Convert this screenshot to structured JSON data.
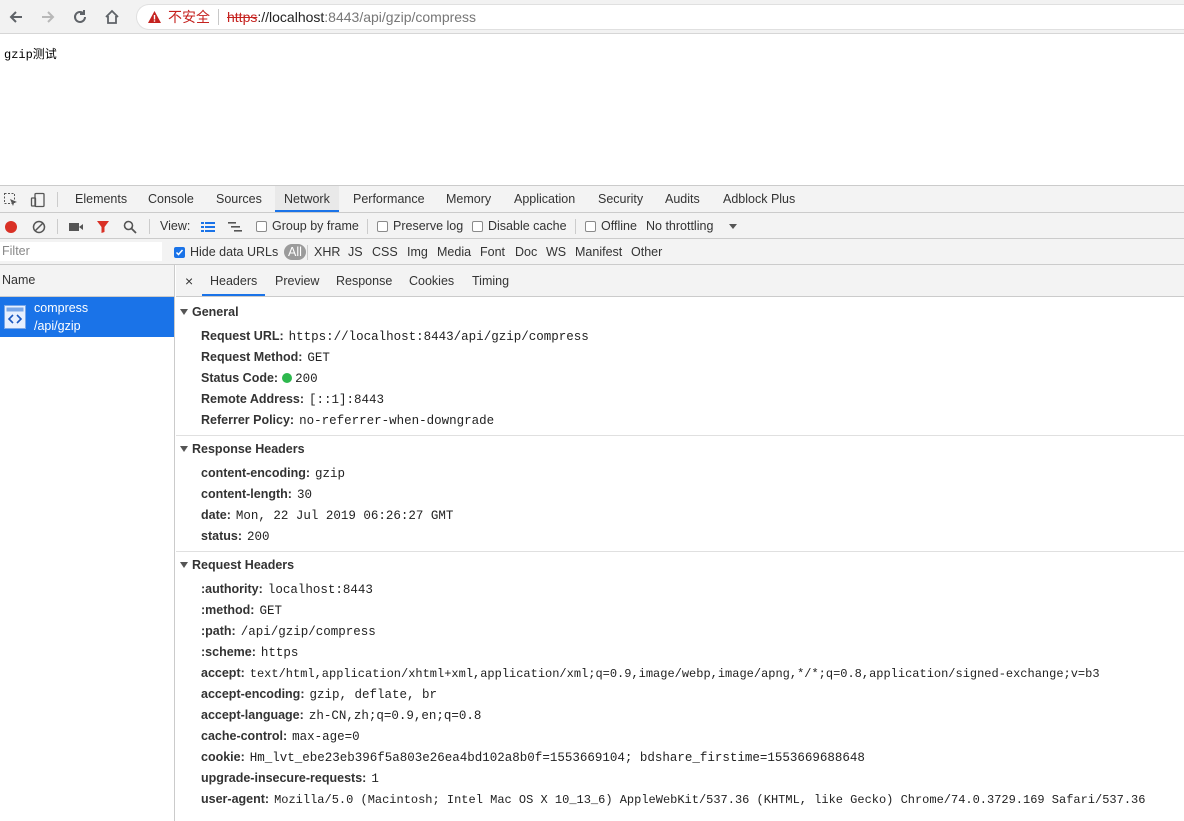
{
  "browser": {
    "insecure_label": "不安全",
    "url_scheme": "https",
    "url_host": "://localhost",
    "url_path": ":8443/api/gzip/compress"
  },
  "page": {
    "text": "gzip测试"
  },
  "devtools": {
    "tabs": [
      "Elements",
      "Console",
      "Sources",
      "Network",
      "Performance",
      "Memory",
      "Application",
      "Security",
      "Audits",
      "Adblock Plus"
    ],
    "toolbar": {
      "view_label": "View:",
      "group_by_frame": "Group by frame",
      "preserve_log": "Preserve log",
      "disable_cache": "Disable cache",
      "offline": "Offline",
      "throttling": "No throttling"
    },
    "filter": {
      "placeholder": "Filter",
      "hide_data_urls": "Hide data URLs",
      "types": [
        "All",
        "XHR",
        "JS",
        "CSS",
        "Img",
        "Media",
        "Font",
        "Doc",
        "WS",
        "Manifest",
        "Other"
      ]
    },
    "list": {
      "header": "Name",
      "request": {
        "name": "compress",
        "path": "/api/gzip"
      }
    },
    "detail_tabs": [
      "Headers",
      "Preview",
      "Response",
      "Cookies",
      "Timing"
    ],
    "general": {
      "title": "General",
      "rows": [
        {
          "k": "Request URL:",
          "v": "https://localhost:8443/api/gzip/compress"
        },
        {
          "k": "Request Method:",
          "v": "GET"
        },
        {
          "k": "Status Code:",
          "v": "200"
        },
        {
          "k": "Remote Address:",
          "v": "[::1]:8443"
        },
        {
          "k": "Referrer Policy:",
          "v": "no-referrer-when-downgrade"
        }
      ]
    },
    "response_headers": {
      "title": "Response Headers",
      "rows": [
        {
          "k": "content-encoding:",
          "v": "gzip"
        },
        {
          "k": "content-length:",
          "v": "30"
        },
        {
          "k": "date:",
          "v": "Mon, 22 Jul 2019 06:26:27 GMT"
        },
        {
          "k": "status:",
          "v": "200"
        }
      ]
    },
    "request_headers": {
      "title": "Request Headers",
      "rows": [
        {
          "k": ":authority:",
          "v": "localhost:8443"
        },
        {
          "k": ":method:",
          "v": "GET"
        },
        {
          "k": ":path:",
          "v": "/api/gzip/compress"
        },
        {
          "k": ":scheme:",
          "v": "https"
        },
        {
          "k": "accept:",
          "v": "text/html,application/xhtml+xml,application/xml;q=0.9,image/webp,image/apng,*/*;q=0.8,application/signed-exchange;v=b3"
        },
        {
          "k": "accept-encoding:",
          "v": "gzip, deflate, br"
        },
        {
          "k": "accept-language:",
          "v": "zh-CN,zh;q=0.9,en;q=0.8"
        },
        {
          "k": "cache-control:",
          "v": "max-age=0"
        },
        {
          "k": "cookie:",
          "v": "Hm_lvt_ebe23eb396f5a803e26ea4bd102a8b0f=1553669104; bdshare_firstime=1553669688648"
        },
        {
          "k": "upgrade-insecure-requests:",
          "v": "1"
        },
        {
          "k": "user-agent:",
          "v": "Mozilla/5.0 (Macintosh; Intel Mac OS X 10_13_6) AppleWebKit/537.36 (KHTML, like Gecko) Chrome/74.0.3729.169 Safari/537.36"
        }
      ]
    }
  }
}
